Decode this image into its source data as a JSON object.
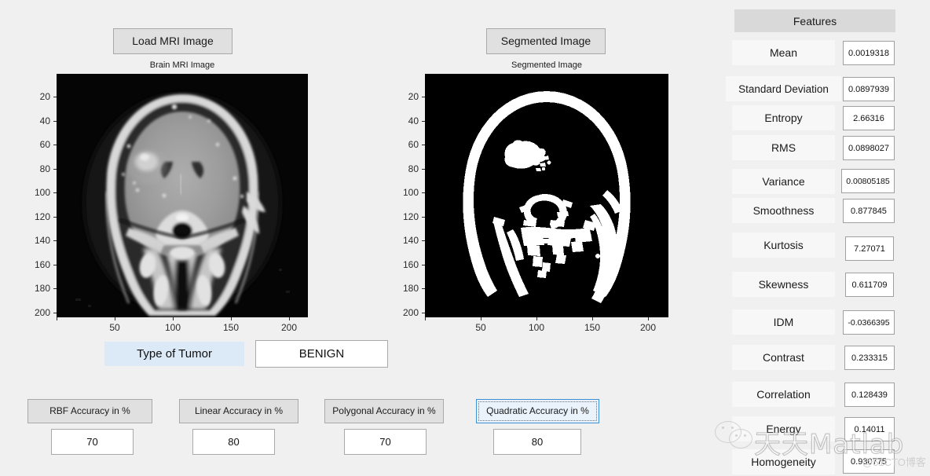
{
  "window": {
    "background": "#f0f0f0"
  },
  "buttons": {
    "load_mri": "Load MRI Image",
    "segmented": "Segmented Image"
  },
  "axes": {
    "left": {
      "title": "Brain MRI Image",
      "xticks": [
        "50",
        "100",
        "150",
        "200"
      ],
      "yticks": [
        "20",
        "40",
        "60",
        "80",
        "100",
        "120",
        "140",
        "160",
        "180",
        "200"
      ],
      "xlim": [
        0,
        220
      ],
      "ylim": [
        0,
        210
      ],
      "image_kind": "coronal-brain-mri-grayscale"
    },
    "right": {
      "title": "Segmented Image",
      "xticks": [
        "50",
        "100",
        "150",
        "200"
      ],
      "yticks": [
        "20",
        "40",
        "60",
        "80",
        "100",
        "120",
        "140",
        "160",
        "180",
        "200"
      ],
      "xlim": [
        0,
        220
      ],
      "ylim": [
        0,
        210
      ],
      "image_kind": "binary-segmentation-mask"
    }
  },
  "tumor": {
    "label": "Type of Tumor",
    "value": "BENIGN",
    "label_background": "#dce9f7"
  },
  "accuracy": [
    {
      "name": "rbf",
      "label": "RBF Accuracy in %",
      "value": "70",
      "focused": false
    },
    {
      "name": "linear",
      "label": "Linear Accuracy in %",
      "value": "80",
      "focused": false
    },
    {
      "name": "polygonal",
      "label": "Polygonal Accuracy in %",
      "value": "70",
      "focused": false
    },
    {
      "name": "quadratic",
      "label": "Quadratic Accuracy in %",
      "value": "80",
      "focused": true
    }
  ],
  "features": {
    "header": "Features",
    "rows": [
      {
        "label": "Mean",
        "value": "0.0019318"
      },
      {
        "label": "Standard Deviation",
        "value": "0.0897939"
      },
      {
        "label": "Entropy",
        "value": "2.66316"
      },
      {
        "label": "RMS",
        "value": "0.0898027"
      },
      {
        "label": "Variance",
        "value": "0.00805185"
      },
      {
        "label": "Smoothness",
        "value": "0.877845"
      },
      {
        "label": "Kurtosis",
        "value": "7.27071"
      },
      {
        "label": "Skewness",
        "value": "0.611709"
      },
      {
        "label": "IDM",
        "value": "-0.0366395"
      },
      {
        "label": "Contrast",
        "value": "0.233315"
      },
      {
        "label": "Correlation",
        "value": "0.128439"
      },
      {
        "label": "Energy",
        "value": "0.14011"
      },
      {
        "label": "Homogeneity",
        "value": "0.930775"
      }
    ]
  },
  "watermark": {
    "main": "天天Matlab",
    "corner": "@51CTO博客"
  }
}
